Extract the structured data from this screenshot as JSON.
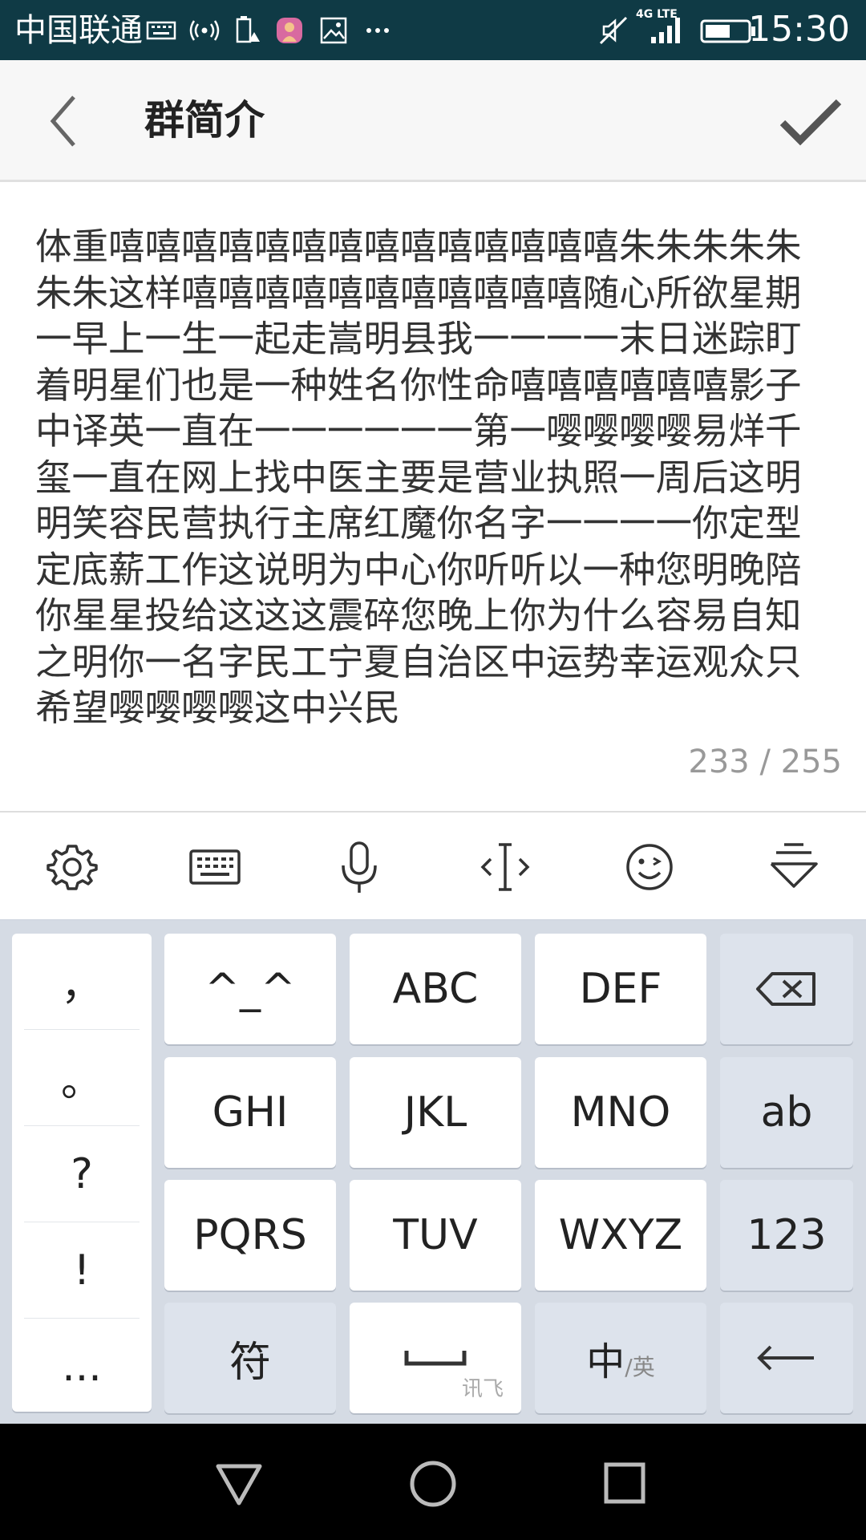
{
  "status_bar": {
    "carrier": "中国联通",
    "network": "4G LTE",
    "time": "15:30",
    "icons": [
      "keyboard-icon",
      "hotspot-icon",
      "battery-saver-icon",
      "app-avatar-icon",
      "image-icon",
      "more-icon",
      "mute-icon",
      "signal-icon",
      "battery-icon"
    ]
  },
  "header": {
    "title": "群简介",
    "back_icon": "chevron-left-icon",
    "done_icon": "checkmark-icon"
  },
  "editor": {
    "text": "体重嘻嘻嘻嘻嘻嘻嘻嘻嘻嘻嘻嘻嘻嘻朱朱朱朱朱朱朱这样嘻嘻嘻嘻嘻嘻嘻嘻嘻嘻嘻随心所欲星期一早上一生一起走嵩明县我一一一一末日迷踪盯着明星们也是一种姓名你性命嘻嘻嘻嘻嘻嘻影子中译英一直在一一一一一一第一嘤嘤嘤嘤易烊千玺一直在网上找中医主要是营业执照一周后这明明笑容民营执行主席红魔你名字一一一一你定型定底薪工作这说明为中心你听听以一种您明晚陪你星星投给这这这震碎您晚上你为什么容易自知之明你一名字民工宁夏自治区中运势幸运观众只希望嘤嘤嘤嘤这中兴民",
    "counter": "233 / 255"
  },
  "keyboard_toolbar": {
    "items": [
      "settings-icon",
      "keyboard-layout-icon",
      "microphone-icon",
      "cursor-icon",
      "emoji-icon",
      "hide-keyboard-icon"
    ]
  },
  "keyboard": {
    "punctuation": [
      "，",
      "。",
      "?",
      "!",
      "..."
    ],
    "keys": {
      "emoticon": "^_^",
      "abc": "ABC",
      "def": "DEF",
      "ghi": "GHI",
      "jkl": "JKL",
      "mno": "MNO",
      "ab": "ab",
      "pqrs": "PQRS",
      "tuv": "TUV",
      "wxyz": "WXYZ",
      "num": "123",
      "symbol": "符",
      "space_sub": "讯飞",
      "lang_main": "中",
      "lang_sub": "/英"
    }
  },
  "nav_bar": {
    "items": [
      "back-triangle-icon",
      "home-circle-icon",
      "recents-square-icon"
    ]
  }
}
